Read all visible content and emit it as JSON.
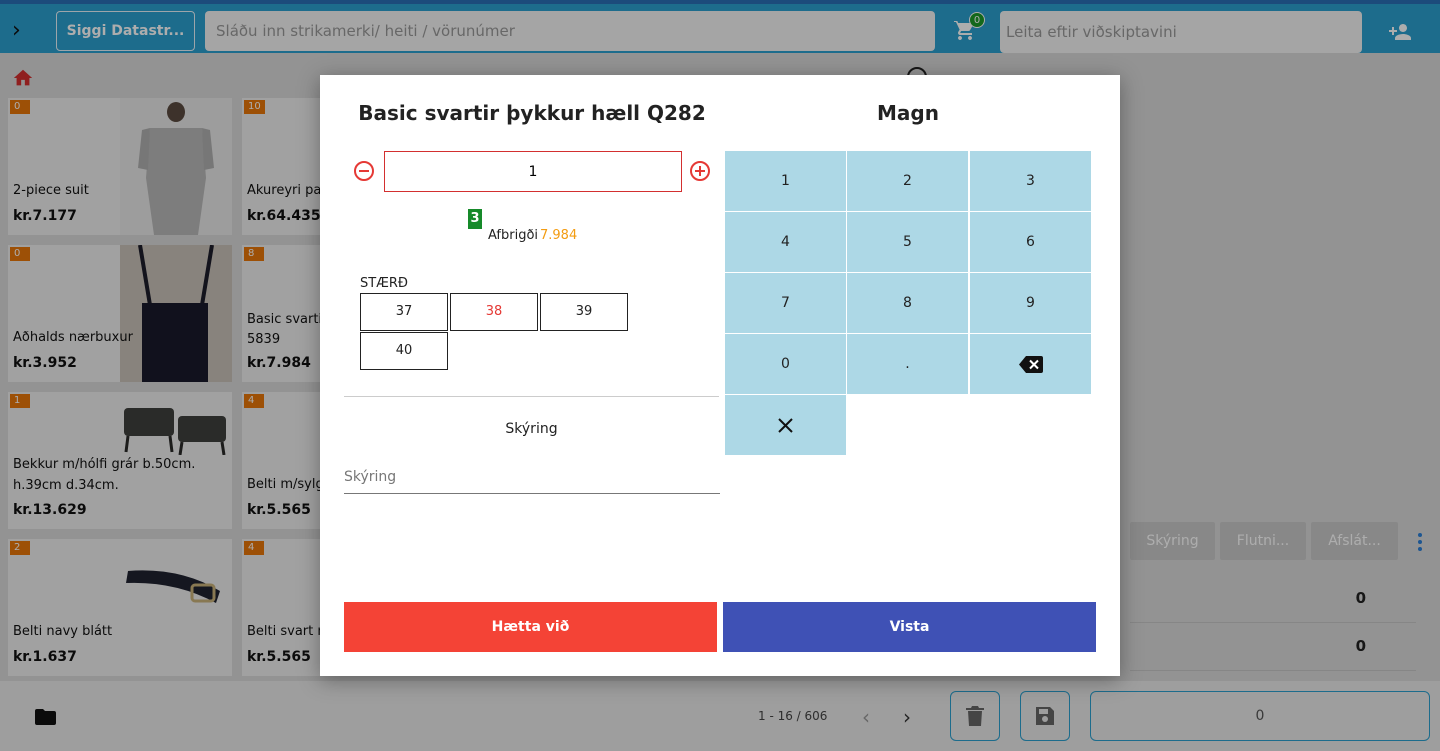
{
  "topbar": {
    "store_button": "Siggi Datastr...",
    "search_placeholder": "Sláðu inn strikamerki/ heiti / vörunúmer",
    "cart_count": "0",
    "customer_search_placeholder": "Leita eftir viðskiptavini"
  },
  "products": [
    {
      "badge": "0",
      "name": "2-piece suit",
      "price": "kr.7.177"
    },
    {
      "badge": "10",
      "name": "Akureyri pa",
      "price": "kr.64.435"
    },
    {
      "badge": "0",
      "name": "Aðhalds nærbuxur",
      "price": "kr.3.952"
    },
    {
      "badge": "8",
      "name": "Basic svarti",
      "name2": "5839",
      "price": "kr.7.984"
    },
    {
      "badge": "1",
      "name": "Bekkur m/hólfi grár b.50cm.",
      "name2": "h.39cm d.34cm.",
      "price": "kr.13.629"
    },
    {
      "badge": "4",
      "name": "Belti m/sylg",
      "price": "kr.5.565"
    },
    {
      "badge": "2",
      "name": "Belti navy blátt",
      "price": "kr.1.637"
    },
    {
      "badge": "4",
      "name": "Belti svart n",
      "price": "kr.5.565"
    }
  ],
  "pager": {
    "text": "1 - 16 / 606"
  },
  "right": {
    "tabs": [
      "Skýring",
      "Flutni...",
      "Afslát..."
    ],
    "rows": [
      "0",
      "0"
    ],
    "total": "0"
  },
  "modal": {
    "title": "Basic svartir þykkur hæll Q282",
    "qty_title": "Magn",
    "qty_value": "1",
    "stock": "3",
    "variant_label": "Afbrigði",
    "variant_price": "7.984",
    "size_label": "STÆRÐ",
    "sizes": [
      "37",
      "38",
      "39",
      "40"
    ],
    "selected_size": "38",
    "desc_heading": "Skýring",
    "desc_placeholder": "Skýring",
    "keys": [
      "1",
      "2",
      "3",
      "4",
      "5",
      "6",
      "7",
      "8",
      "9",
      "0",
      "."
    ],
    "cancel_label": "Hætta við",
    "save_label": "Vista"
  },
  "colors": {
    "topbar": "#2b9fce",
    "badge": "#e8760a",
    "key": "#add8e6",
    "cancel": "#f44336",
    "save": "#3f51b5",
    "variant_price": "#f39c12",
    "stock": "#168a2a"
  },
  "icons": [
    "chevron-right-icon",
    "cart-icon",
    "add-user-icon",
    "home-icon",
    "clock-icon",
    "minus-circle-icon",
    "plus-circle-icon",
    "backspace-icon",
    "clear-icon",
    "folder-icon",
    "chevron-left-icon",
    "kebab-icon",
    "trash-icon",
    "save-icon"
  ]
}
